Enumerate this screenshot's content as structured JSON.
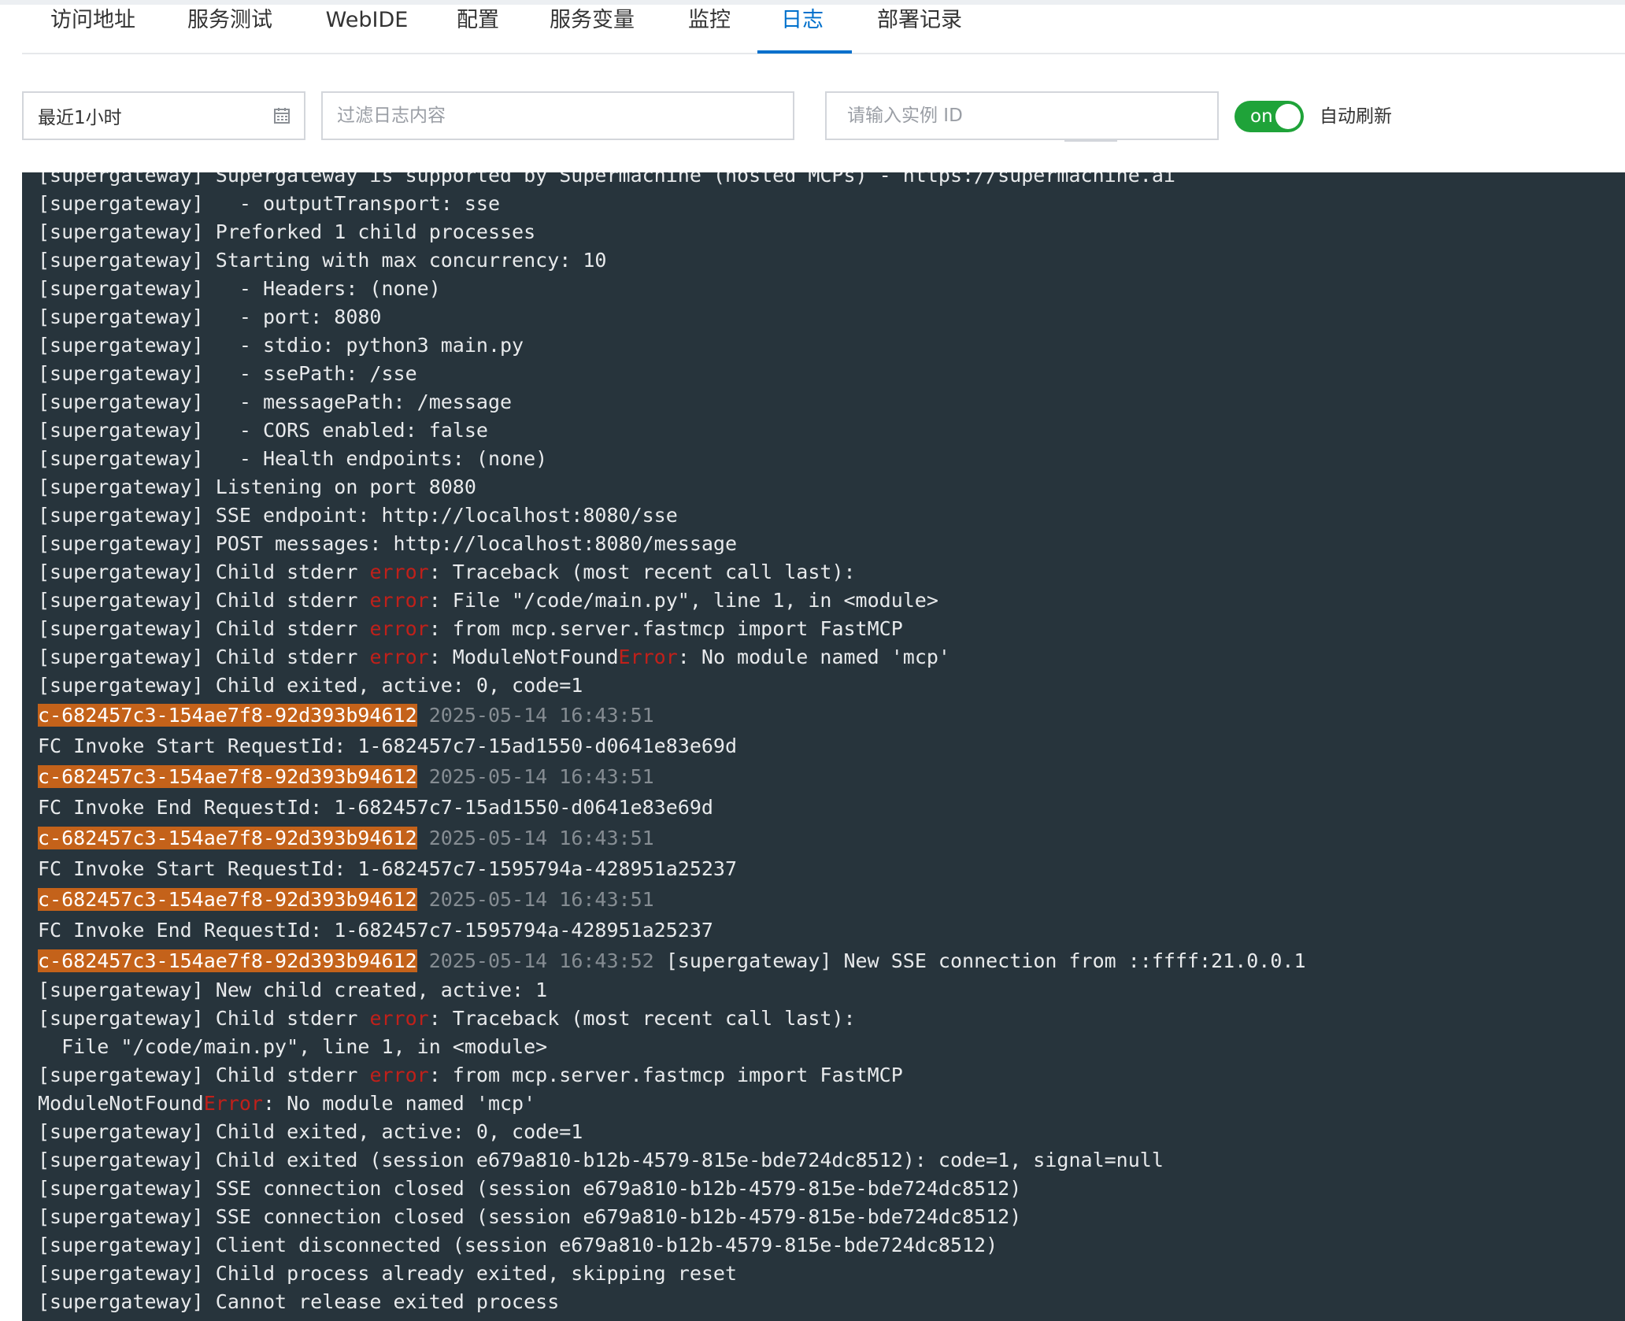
{
  "tabs": [
    {
      "label": "访问地址",
      "active": false
    },
    {
      "label": "服务测试",
      "active": false
    },
    {
      "label": "WebIDE",
      "active": false
    },
    {
      "label": "配置",
      "active": false
    },
    {
      "label": "服务变量",
      "active": false
    },
    {
      "label": "监控",
      "active": false
    },
    {
      "label": "日志",
      "active": true
    },
    {
      "label": "部署记录",
      "active": false
    }
  ],
  "filters": {
    "time_range_value": "最近1小时",
    "filter_placeholder": "过滤日志内容",
    "instance_placeholder": "请输入实例 ID",
    "auto_refresh_state": "on",
    "auto_refresh_label": "自动刷新"
  },
  "colors": {
    "accent": "#0070cc",
    "toggle_on": "#1fa339",
    "log_background": "#27343c",
    "error_text": "#c0201a",
    "instance_highlight": "#c4621a"
  },
  "icons": [
    "calendar-icon",
    "search-icon"
  ],
  "log_lines": [
    {
      "type": "plain",
      "segments": [
        {
          "text": "[supergateway] Supergateway is supported by Supermachine (hosted MCPs) - https://supermachine.ai",
          "style": "normal"
        }
      ]
    },
    {
      "type": "plain",
      "segments": [
        {
          "text": "[supergateway]   - outputTransport: sse",
          "style": "normal"
        }
      ]
    },
    {
      "type": "plain",
      "segments": [
        {
          "text": "[supergateway] Preforked 1 child processes",
          "style": "normal"
        }
      ]
    },
    {
      "type": "plain",
      "segments": [
        {
          "text": "[supergateway] Starting with max concurrency: 10",
          "style": "normal"
        }
      ]
    },
    {
      "type": "plain",
      "segments": [
        {
          "text": "[supergateway]   - Headers: (none)",
          "style": "normal"
        }
      ]
    },
    {
      "type": "plain",
      "segments": [
        {
          "text": "[supergateway]   - port: 8080",
          "style": "normal"
        }
      ]
    },
    {
      "type": "plain",
      "segments": [
        {
          "text": "[supergateway]   - stdio: python3 main.py",
          "style": "normal"
        }
      ]
    },
    {
      "type": "plain",
      "segments": [
        {
          "text": "[supergateway]   - ssePath: /sse",
          "style": "normal"
        }
      ]
    },
    {
      "type": "plain",
      "segments": [
        {
          "text": "[supergateway]   - messagePath: /message",
          "style": "normal"
        }
      ]
    },
    {
      "type": "plain",
      "segments": [
        {
          "text": "[supergateway]   - CORS enabled: false",
          "style": "normal"
        }
      ]
    },
    {
      "type": "plain",
      "segments": [
        {
          "text": "[supergateway]   - Health endpoints: (none)",
          "style": "normal"
        }
      ]
    },
    {
      "type": "plain",
      "segments": [
        {
          "text": "[supergateway] Listening on port 8080",
          "style": "normal"
        }
      ]
    },
    {
      "type": "plain",
      "segments": [
        {
          "text": "[supergateway] SSE endpoint: http://localhost:8080/sse",
          "style": "normal"
        }
      ]
    },
    {
      "type": "plain",
      "segments": [
        {
          "text": "[supergateway] POST messages: http://localhost:8080/message",
          "style": "normal"
        }
      ]
    },
    {
      "type": "plain",
      "segments": [
        {
          "text": "[supergateway] Child stderr ",
          "style": "normal"
        },
        {
          "text": "error",
          "style": "error"
        },
        {
          "text": ": Traceback (most recent call last):",
          "style": "normal"
        }
      ]
    },
    {
      "type": "plain",
      "segments": [
        {
          "text": "[supergateway] Child stderr ",
          "style": "normal"
        },
        {
          "text": "error",
          "style": "error"
        },
        {
          "text": ": File \"/code/main.py\", line 1, in <module>",
          "style": "normal"
        }
      ]
    },
    {
      "type": "plain",
      "segments": [
        {
          "text": "[supergateway] Child stderr ",
          "style": "normal"
        },
        {
          "text": "error",
          "style": "error"
        },
        {
          "text": ": from mcp.server.fastmcp import FastMCP",
          "style": "normal"
        }
      ]
    },
    {
      "type": "plain",
      "segments": [
        {
          "text": "[supergateway] Child stderr ",
          "style": "normal"
        },
        {
          "text": "error",
          "style": "error"
        },
        {
          "text": ": ModuleNotFound",
          "style": "normal"
        },
        {
          "text": "Error",
          "style": "error"
        },
        {
          "text": ": No module named 'mcp'",
          "style": "normal"
        }
      ]
    },
    {
      "type": "plain",
      "segments": [
        {
          "text": "[supergateway] Child exited, active: 0, code=1",
          "style": "normal"
        }
      ]
    },
    {
      "type": "head",
      "segments": [
        {
          "text": "c-682457c3-154ae7f8-92d393b94612",
          "style": "instance"
        },
        {
          "text": " ",
          "style": "normal"
        },
        {
          "text": "2025-05-14 16:43:51",
          "style": "timestamp"
        }
      ]
    },
    {
      "type": "head",
      "segments": [
        {
          "text": "FC Invoke Start RequestId: 1-682457c7-15ad1550-d0641e83e69d",
          "style": "normal"
        }
      ]
    },
    {
      "type": "head",
      "segments": [
        {
          "text": "c-682457c3-154ae7f8-92d393b94612",
          "style": "instance"
        },
        {
          "text": " ",
          "style": "normal"
        },
        {
          "text": "2025-05-14 16:43:51",
          "style": "timestamp"
        }
      ]
    },
    {
      "type": "head",
      "segments": [
        {
          "text": "FC Invoke End RequestId: 1-682457c7-15ad1550-d0641e83e69d",
          "style": "normal"
        }
      ]
    },
    {
      "type": "head",
      "segments": [
        {
          "text": "c-682457c3-154ae7f8-92d393b94612",
          "style": "instance"
        },
        {
          "text": " ",
          "style": "normal"
        },
        {
          "text": "2025-05-14 16:43:51",
          "style": "timestamp"
        }
      ]
    },
    {
      "type": "head",
      "segments": [
        {
          "text": "FC Invoke Start RequestId: 1-682457c7-1595794a-428951a25237",
          "style": "normal"
        }
      ]
    },
    {
      "type": "head",
      "segments": [
        {
          "text": "c-682457c3-154ae7f8-92d393b94612",
          "style": "instance"
        },
        {
          "text": " ",
          "style": "normal"
        },
        {
          "text": "2025-05-14 16:43:51",
          "style": "timestamp"
        }
      ]
    },
    {
      "type": "head",
      "segments": [
        {
          "text": "FC Invoke End RequestId: 1-682457c7-1595794a-428951a25237",
          "style": "normal"
        }
      ]
    },
    {
      "type": "head",
      "segments": [
        {
          "text": "c-682457c3-154ae7f8-92d393b94612",
          "style": "instance"
        },
        {
          "text": " ",
          "style": "normal"
        },
        {
          "text": "2025-05-14 16:43:52",
          "style": "timestamp"
        },
        {
          "text": " [supergateway] New SSE connection from ::ffff:21.0.0.1",
          "style": "normal"
        }
      ]
    },
    {
      "type": "plain",
      "segments": [
        {
          "text": "[supergateway] New child created, active: 1",
          "style": "normal"
        }
      ]
    },
    {
      "type": "plain",
      "segments": [
        {
          "text": "[supergateway] Child stderr ",
          "style": "normal"
        },
        {
          "text": "error",
          "style": "error"
        },
        {
          "text": ": Traceback (most recent call last):",
          "style": "normal"
        }
      ]
    },
    {
      "type": "plain",
      "segments": [
        {
          "text": "  File \"/code/main.py\", line 1, in <module>",
          "style": "normal"
        }
      ]
    },
    {
      "type": "plain",
      "segments": [
        {
          "text": "[supergateway] Child stderr ",
          "style": "normal"
        },
        {
          "text": "error",
          "style": "error"
        },
        {
          "text": ": from mcp.server.fastmcp import FastMCP",
          "style": "normal"
        }
      ]
    },
    {
      "type": "plain",
      "segments": [
        {
          "text": "ModuleNotFound",
          "style": "normal"
        },
        {
          "text": "Error",
          "style": "error"
        },
        {
          "text": ": No module named 'mcp'",
          "style": "normal"
        }
      ]
    },
    {
      "type": "plain",
      "segments": [
        {
          "text": "[supergateway] Child exited, active: 0, code=1",
          "style": "normal"
        }
      ]
    },
    {
      "type": "plain",
      "segments": [
        {
          "text": "[supergateway] Child exited (session e679a810-b12b-4579-815e-bde724dc8512): code=1, signal=null",
          "style": "normal"
        }
      ]
    },
    {
      "type": "plain",
      "segments": [
        {
          "text": "[supergateway] SSE connection closed (session e679a810-b12b-4579-815e-bde724dc8512)",
          "style": "normal"
        }
      ]
    },
    {
      "type": "plain",
      "segments": [
        {
          "text": "[supergateway] SSE connection closed (session e679a810-b12b-4579-815e-bde724dc8512)",
          "style": "normal"
        }
      ]
    },
    {
      "type": "plain",
      "segments": [
        {
          "text": "[supergateway] Client disconnected (session e679a810-b12b-4579-815e-bde724dc8512)",
          "style": "normal"
        }
      ]
    },
    {
      "type": "plain",
      "segments": [
        {
          "text": "[supergateway] Child process already exited, skipping reset",
          "style": "normal"
        }
      ]
    },
    {
      "type": "plain",
      "segments": [
        {
          "text": "[supergateway] Cannot release exited process",
          "style": "normal"
        }
      ]
    }
  ]
}
